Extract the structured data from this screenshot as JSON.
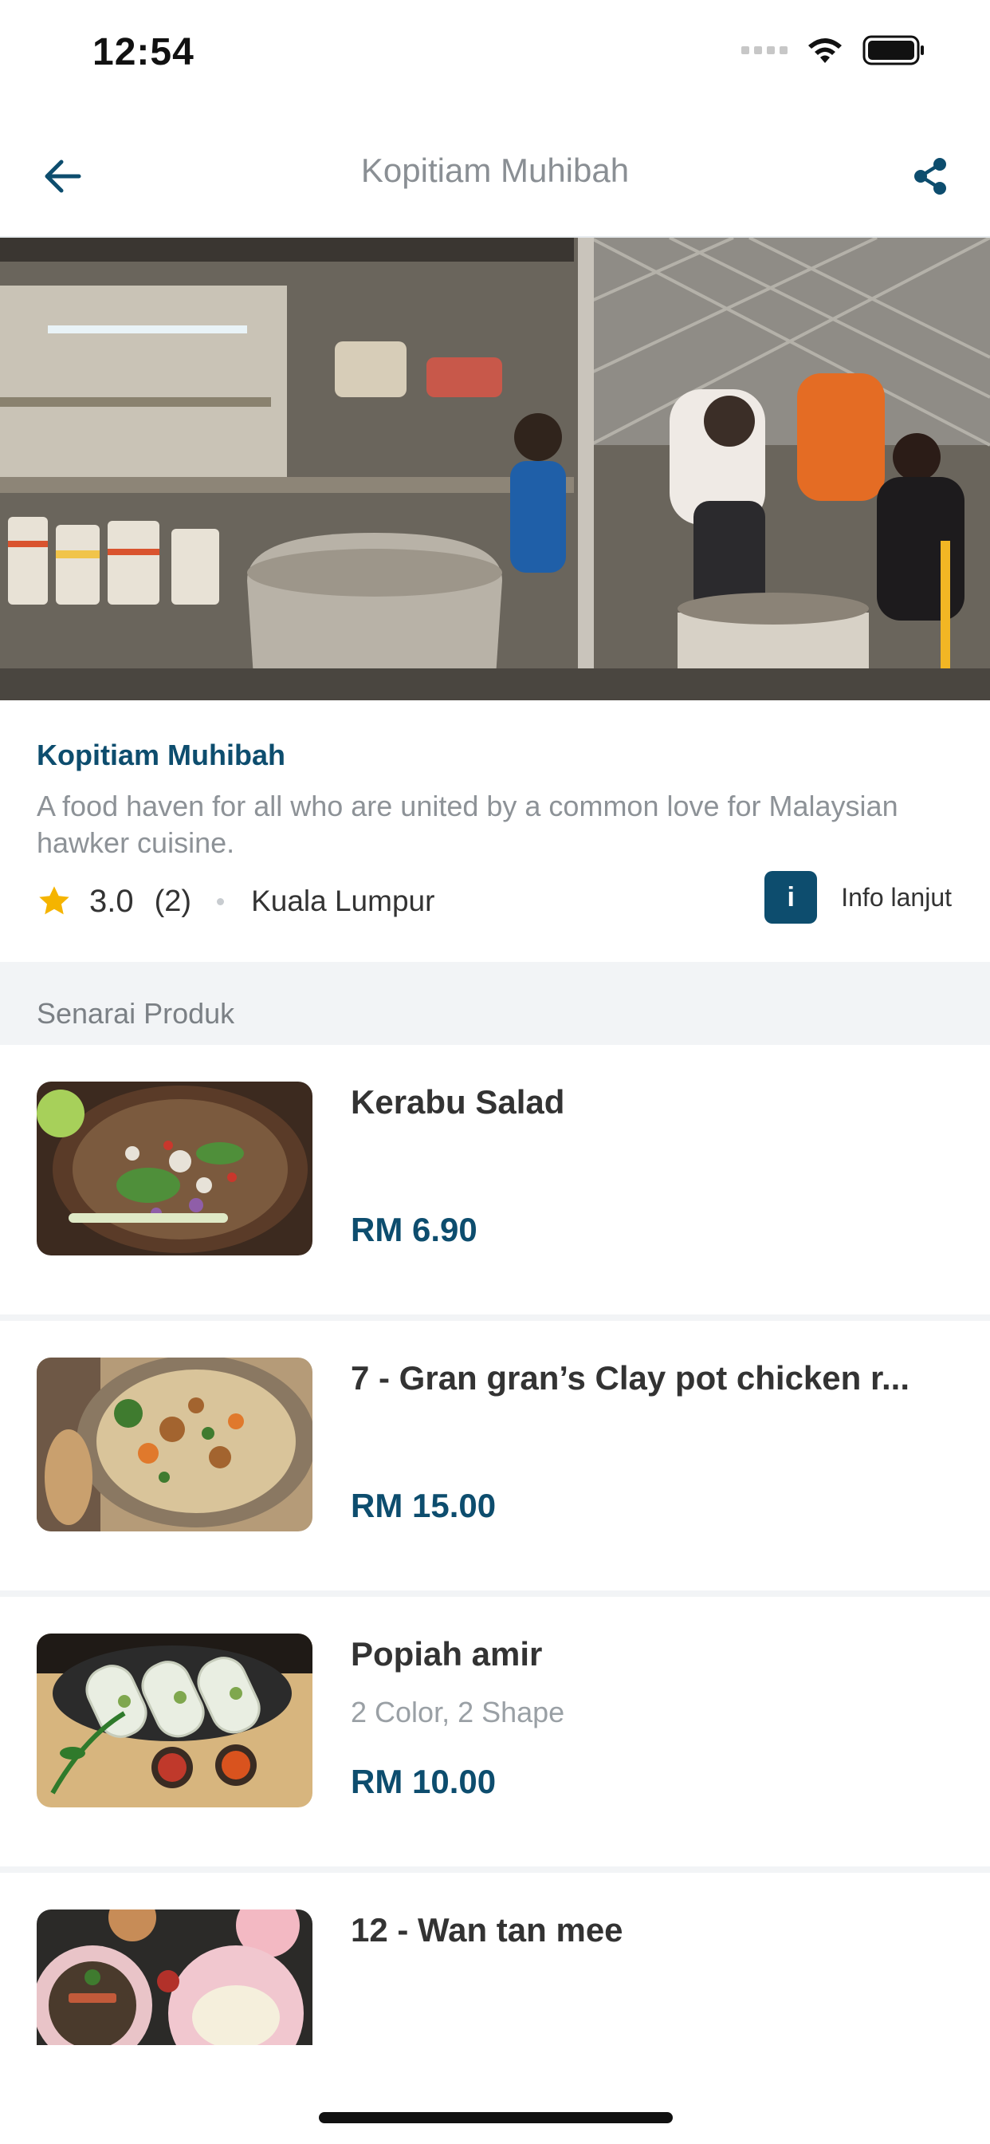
{
  "status_bar": {
    "time": "12:54"
  },
  "nav": {
    "title": "Kopitiam Muhibah",
    "back_icon": "arrow-left-icon",
    "share_icon": "share-icon"
  },
  "store": {
    "name": "Kopitiam Muhibah",
    "description": "A food haven for all who are united by a common love for Malaysian hawker cuisine.",
    "rating": "3.0",
    "review_count": "(2)",
    "location": "Kuala Lumpur",
    "info_icon_glyph": "i",
    "info_label": "Info lanjut"
  },
  "section": {
    "title": "Senarai Produk"
  },
  "products": [
    {
      "name": "Kerabu Salad",
      "variant": "",
      "price": "RM 6.90"
    },
    {
      "name": "7 - Gran gran’s Clay pot chicken r...",
      "variant": "",
      "price": "RM 15.00"
    },
    {
      "name": "Popiah amir",
      "variant": "2 Color, 2 Shape",
      "price": "RM 10.00"
    },
    {
      "name": "12 - Wan tan mee",
      "variant": "",
      "price": ""
    }
  ],
  "colors": {
    "primary": "#0d4d6e",
    "star": "#f5b400",
    "muted": "#8d9297",
    "divider": "#f2f4f6"
  }
}
